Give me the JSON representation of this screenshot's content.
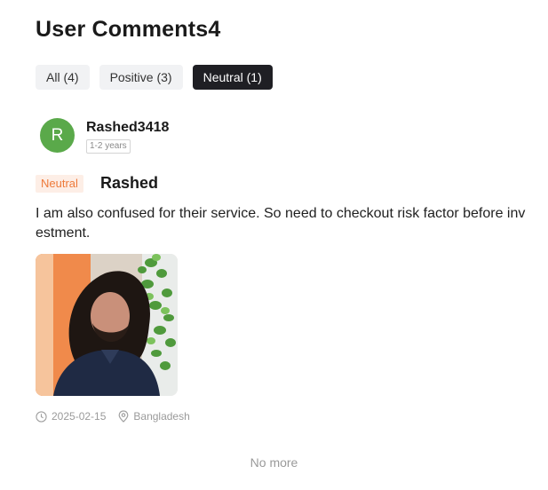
{
  "header": {
    "title": "User Comments4"
  },
  "tabs": [
    {
      "label": "All (4)",
      "active": false
    },
    {
      "label": "Positive (3)",
      "active": false
    },
    {
      "label": "Neutral (1)",
      "active": true
    }
  ],
  "comment": {
    "avatar_letter": "R",
    "username": "Rashed3418",
    "experience": "1-2 years",
    "sentiment_tag": "Neutral",
    "title": "Rashed",
    "body": "I am also confused for their service. So need to checkout risk factor before investment.",
    "photo": "user-photo",
    "date": "2025-02-15",
    "location": "Bangladesh"
  },
  "footer": {
    "no_more": "No more"
  },
  "colors": {
    "avatar": "#5aa94a",
    "tag_bg": "#fdeee6",
    "tag_text": "#ee7a3a",
    "active_tab_bg": "#1f1f24"
  }
}
